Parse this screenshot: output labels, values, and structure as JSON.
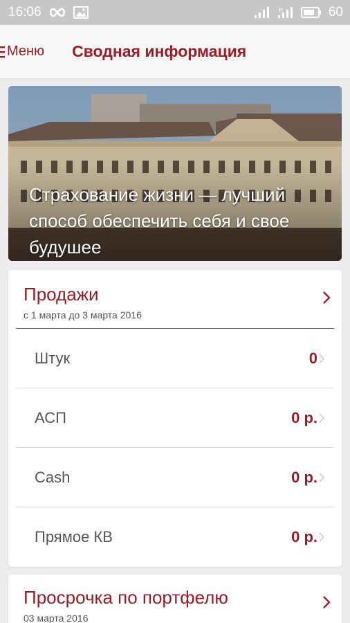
{
  "status_bar": {
    "time": "16:06",
    "battery": "60",
    "left_icons": [
      "infinity-icon",
      "image-icon"
    ],
    "right_icons": [
      "signal-icon",
      "signal-h-icon",
      "battery-icon"
    ]
  },
  "app_bar": {
    "menu_label": "Меню",
    "title": "Сводная информация"
  },
  "hero": {
    "text": "Страхование жизни — лучший способ обеспечить себя и свое будушее"
  },
  "sales_card": {
    "title": "Продажи",
    "subtitle": "с 1 марта до 3 марта 2016",
    "rows": [
      {
        "label": "Штук",
        "value": "0"
      },
      {
        "label": "АСП",
        "value": "0 р."
      },
      {
        "label": "Cash",
        "value": "0 р."
      },
      {
        "label": "Прямое КВ",
        "value": "0 р."
      }
    ]
  },
  "overdue_card": {
    "title": "Просрочка по портфелю",
    "subtitle": "03 марта 2016"
  },
  "colors": {
    "accent": "#9c1d25",
    "status_bar": "#c7c7c7",
    "app_bar": "#f7f7f7",
    "background": "#ececec"
  }
}
